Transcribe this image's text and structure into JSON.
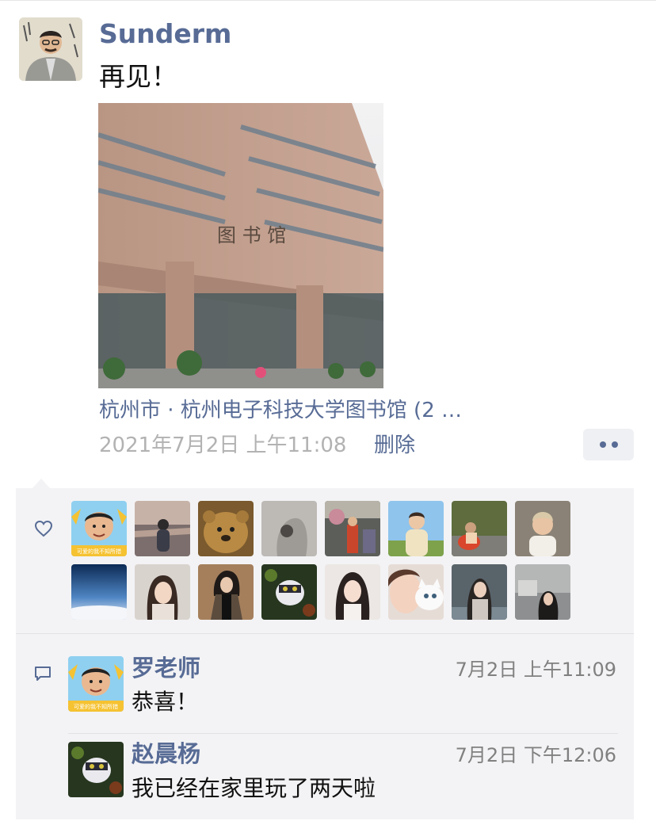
{
  "post": {
    "author": "Sunderm",
    "text": "再见！",
    "location": "杭州市 · 杭州电子科技大学图书馆 (2 …",
    "photo_sign": "图 书 馆",
    "timestamp": "2021年7月2日 上午11:08",
    "delete_label": "删除"
  },
  "avatar_overlay_text": "可爱的我不知所措",
  "likers_count": 16,
  "comments": [
    {
      "name": "罗老师",
      "text": "恭喜！",
      "time": "7月2日 上午11:09"
    },
    {
      "name": "赵晨杨",
      "text": "我已经在家里玩了两天啦",
      "time": "7月2日 下午12:06"
    }
  ],
  "colors": {
    "link": "#576b95",
    "panel": "#f3f3f5",
    "timestamp": "#b2b2b2"
  }
}
